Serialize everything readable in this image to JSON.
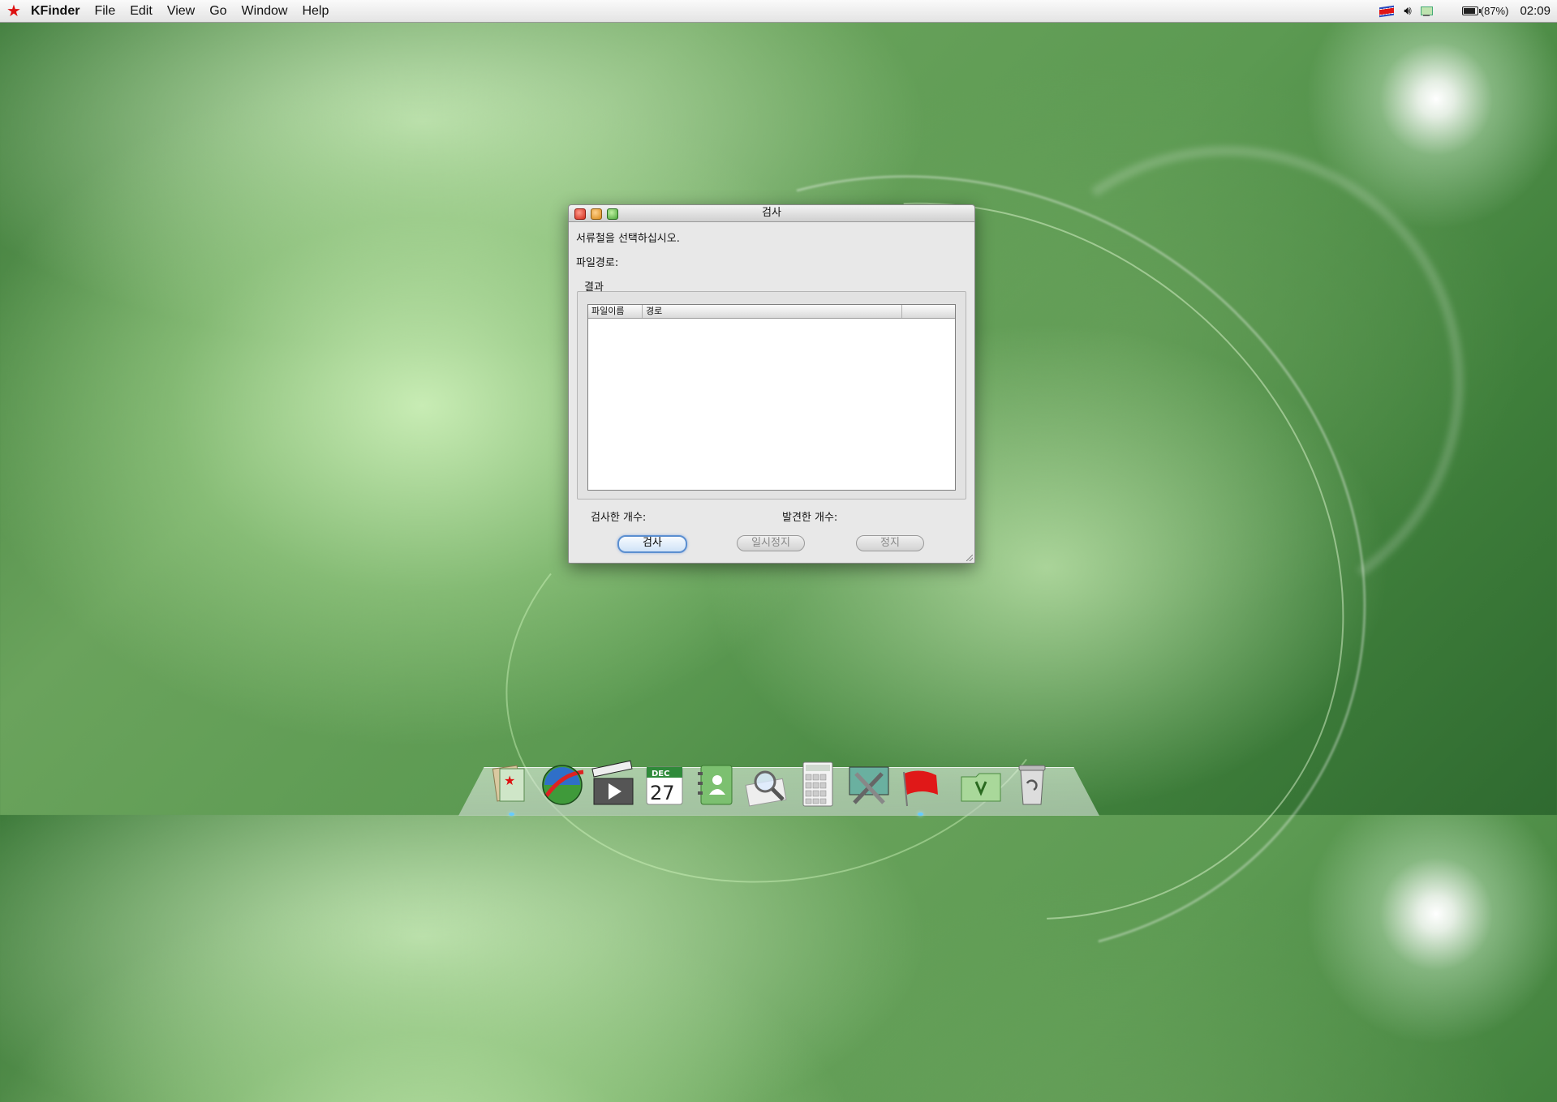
{
  "menubar": {
    "app_name": "KFinder",
    "items": [
      "File",
      "Edit",
      "View",
      "Go",
      "Window",
      "Help"
    ],
    "battery_text": "(87%)",
    "battery_level": 0.87,
    "clock": "02:09"
  },
  "dialog": {
    "title": "검사",
    "prompt": "서류철을 선택하십시오.",
    "path_label": "파일경로:",
    "results_group_title": "결과",
    "table": {
      "columns": [
        "파일이름",
        "경로"
      ],
      "rows": []
    },
    "scanned_count_label": "검사한 개수:",
    "found_count_label": "발견한 개수:",
    "buttons": {
      "scan": "검사",
      "pause": "일시정지",
      "stop": "정지"
    }
  },
  "dock": {
    "items": [
      {
        "icon": "kfinder-icon"
      },
      {
        "icon": "browser-globe-icon"
      },
      {
        "icon": "movie-clapper-icon"
      },
      {
        "icon": "calendar-icon",
        "month": "DEC",
        "day": "27"
      },
      {
        "icon": "address-book-icon"
      },
      {
        "icon": "search-magnifier-icon"
      },
      {
        "icon": "calculator-icon"
      },
      {
        "icon": "system-preferences-icon"
      },
      {
        "icon": "red-flag-icon"
      },
      {
        "icon": "documents-folder-icon"
      },
      {
        "icon": "trash-icon"
      }
    ]
  }
}
